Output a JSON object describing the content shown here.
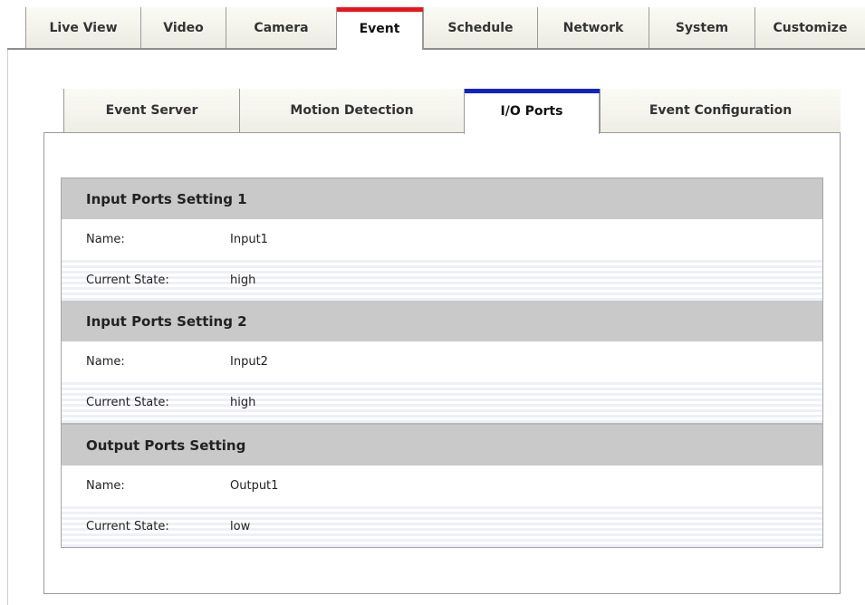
{
  "top_tabs": [
    {
      "label": "Live View"
    },
    {
      "label": "Video"
    },
    {
      "label": "Camera"
    },
    {
      "label": "Event",
      "active": true
    },
    {
      "label": "Schedule"
    },
    {
      "label": "Network"
    },
    {
      "label": "System"
    },
    {
      "label": "Customize"
    }
  ],
  "sub_tabs": [
    {
      "label": "Event Server"
    },
    {
      "label": "Motion Detection"
    },
    {
      "label": "I/O Ports",
      "active": true
    },
    {
      "label": "Event Configuration"
    }
  ],
  "accent_colors": {
    "top_tab_active": "#e8161c",
    "sub_tab_active": "#1122cc"
  },
  "groups": [
    {
      "title": "Input Ports Setting 1",
      "rows": [
        {
          "label": "Name:",
          "value": "Input1"
        },
        {
          "label": "Current State:",
          "value": "high"
        }
      ]
    },
    {
      "title": "Input Ports Setting 2",
      "rows": [
        {
          "label": "Name:",
          "value": "Input2"
        },
        {
          "label": "Current State:",
          "value": "high"
        }
      ]
    },
    {
      "title": "Output Ports Setting",
      "rows": [
        {
          "label": "Name:",
          "value": "Output1"
        },
        {
          "label": "Current State:",
          "value": "low"
        }
      ]
    }
  ]
}
